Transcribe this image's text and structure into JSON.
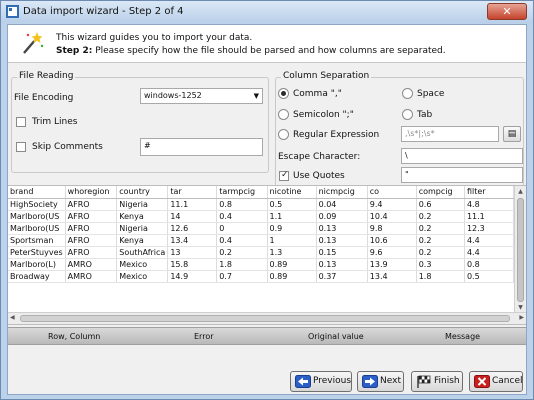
{
  "window": {
    "title": "Data import wizard - Step 2 of 4",
    "close_glyph": "✕"
  },
  "header": {
    "line1": "This wizard guides you to import your data.",
    "step_label": "Step 2:",
    "line2": " Please specify how the file should be parsed and how columns are separated."
  },
  "file_reading": {
    "group_title": "File Reading",
    "encoding_label": "File Encoding",
    "encoding_value": "windows-1252",
    "trim_lines_label": "Trim Lines",
    "trim_lines_checked": false,
    "skip_comments_label": "Skip Comments",
    "skip_comments_checked": false,
    "comment_char": "#"
  },
  "column_separation": {
    "group_title": "Column Separation",
    "comma_label": "Comma \",\"",
    "space_label": "Space",
    "semicolon_label": "Semicolon \";\"",
    "tab_label": "Tab",
    "regex_label": "Regular Expression",
    "regex_value": ",\\s*|;\\s*",
    "selected": "comma",
    "escape_label": "Escape Character:",
    "escape_value": "\\",
    "use_quotes_label": "Use Quotes",
    "use_quotes_checked": true,
    "quote_value": "\""
  },
  "preview": {
    "columns": [
      "brand",
      "whoregion",
      "country",
      "tar",
      "tarmpcig",
      "nicotine",
      "nicmpcig",
      "co",
      "compcig",
      "filter"
    ],
    "rows": [
      [
        "HighSociety",
        "AFRO",
        "Nigeria",
        "11.1",
        "0.8",
        "0.5",
        "0.04",
        "9.4",
        "0.6",
        "4.8"
      ],
      [
        "Marlboro(US",
        "AFRO",
        "Kenya",
        "14",
        "0.4",
        "1.1",
        "0.09",
        "10.4",
        "0.2",
        "11.1"
      ],
      [
        "Marlboro(US",
        "AFRO",
        "Nigeria",
        "12.6",
        "0",
        "0.9",
        "0.13",
        "9.8",
        "0.2",
        "12.3"
      ],
      [
        "Sportsman",
        "AFRO",
        "Kenya",
        "13.4",
        "0.4",
        "1",
        "0.13",
        "10.6",
        "0.2",
        "4.4"
      ],
      [
        "PeterStuyves",
        "AFRO",
        "SouthAfrica",
        "13",
        "0.2",
        "1.3",
        "0.15",
        "9.6",
        "0.2",
        "4.4"
      ],
      [
        "Marlboro(L)",
        "AMRO",
        "Mexico",
        "15.8",
        "1.8",
        "0.89",
        "0.13",
        "13.9",
        "0.3",
        "0.8"
      ],
      [
        "Broadway",
        "AMRO",
        "Mexico",
        "14.9",
        "0.7",
        "0.89",
        "0.37",
        "13.4",
        "1.8",
        "0.5"
      ]
    ]
  },
  "error_log": {
    "columns": [
      "Row, Column",
      "Error",
      "Original value",
      "Message"
    ]
  },
  "buttons": {
    "previous": "Previous",
    "next": "Next",
    "finish": "Finish",
    "cancel": "Cancel"
  },
  "colors": {
    "title_bg": "#c9dcef",
    "close_red": "#c5432b",
    "cancel_red": "#c8201e",
    "next_blue": "#2b5fc7"
  }
}
